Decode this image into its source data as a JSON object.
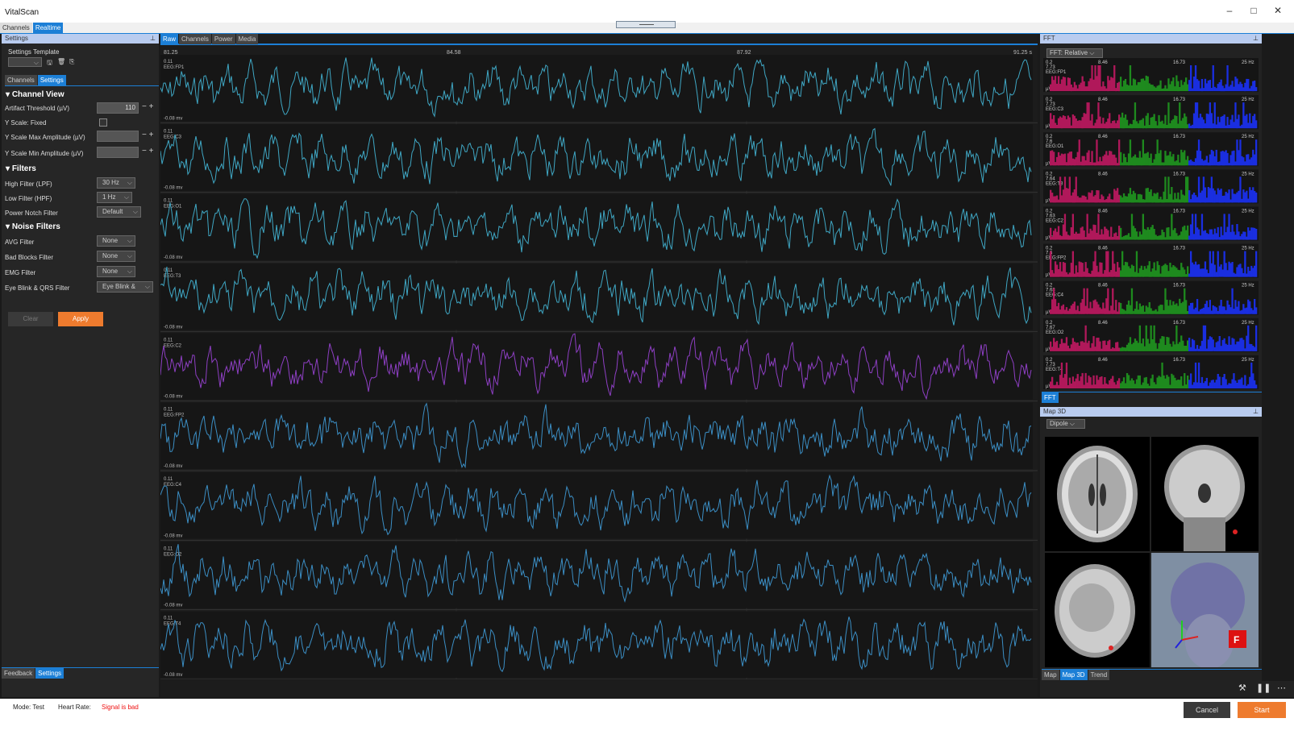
{
  "app": {
    "title": "VitalScan"
  },
  "top_tabs": [
    {
      "label": "Channels"
    },
    {
      "label": "Realtime"
    }
  ],
  "settings_panel": {
    "title": "Settings",
    "template_label": "Settings Template",
    "sub_tabs": [
      {
        "label": "Channels"
      },
      {
        "label": "Settings"
      }
    ],
    "channel_view": {
      "title": "Channel View",
      "artifact_threshold_label": "Artifact Threshold (µV)",
      "artifact_threshold_value": "110",
      "y_scale_fixed_label": "Y Scale: Fixed",
      "y_max_label": "Y Scale Max Amplitude (µV)",
      "y_min_label": "Y Scale Min Amplitude (µV)"
    },
    "filters": {
      "title": "Filters",
      "high_label": "High Filter (LPF)",
      "high_value": "30 Hz",
      "low_label": "Low Filter (HPF)",
      "low_value": "1 Hz",
      "notch_label": "Power Notch Filter",
      "notch_value": "Default"
    },
    "noise_filters": {
      "title": "Noise Filters",
      "avg_label": "AVG Filter",
      "avg_value": "None",
      "bad_blocks_label": "Bad Blocks Filter",
      "bad_blocks_value": "None",
      "emg_label": "EMG Filter",
      "emg_value": "None",
      "eye_blink_label": "Eye Blink & QRS Filter",
      "eye_blink_value": "Eye Blink &"
    },
    "clear_label": "Clear",
    "apply_label": "Apply",
    "bottom_tabs": [
      {
        "label": "Feedback"
      },
      {
        "label": "Settings"
      }
    ]
  },
  "center": {
    "tabs": [
      {
        "label": "Raw"
      },
      {
        "label": "Channels"
      },
      {
        "label": "Power"
      },
      {
        "label": "Media"
      }
    ],
    "time_ticks": [
      "81.25",
      "84.58",
      "87.92",
      "91.25 s"
    ],
    "amp_top": "0.11",
    "amp_bottom": "-0.08 mv",
    "channels": [
      {
        "name": "EEG:FP1",
        "color": "#3fa7c4"
      },
      {
        "name": "EEG:C3",
        "color": "#3fa7c4"
      },
      {
        "name": "EEG:O1",
        "color": "#3fa7c4"
      },
      {
        "name": "EEG:T3",
        "color": "#3fa7c4"
      },
      {
        "name": "EEG:C2",
        "color": "#8e3fc4"
      },
      {
        "name": "EEG:FP2",
        "color": "#3b8ec4"
      },
      {
        "name": "EEG:C4",
        "color": "#3b8ec4"
      },
      {
        "name": "EEG:O2",
        "color": "#3b8ec4"
      },
      {
        "name": "EEG:T4",
        "color": "#3b8ec4"
      }
    ]
  },
  "fft_panel": {
    "title": "FFT",
    "mode_value": "FFT: Relative",
    "freq_ticks": [
      "8.46",
      "16.73",
      "25 Hz"
    ],
    "y_top": "0.2",
    "y_unit": "µV²",
    "band_colors": [
      "#b0185a",
      "#1e8a1e",
      "#1a2ee0"
    ],
    "channels": [
      {
        "name": "EEG:FP1",
        "sub": "7.73"
      },
      {
        "name": "EEG:C3",
        "sub": "7.73"
      },
      {
        "name": "EEG:O1",
        "sub": "7.6"
      },
      {
        "name": "EEG:T3",
        "sub": "7.64"
      },
      {
        "name": "EEG:C2",
        "sub": "7.63"
      },
      {
        "name": "EEG:FP2",
        "sub": "7.6"
      },
      {
        "name": "EEG:C4",
        "sub": "7.68"
      },
      {
        "name": "EEG:O2",
        "sub": "7.67"
      },
      {
        "name": "EEG:T4",
        "sub": "7.73"
      }
    ],
    "bottom_tab": "FFT"
  },
  "map_panel": {
    "title": "Map 3D",
    "mode_value": "Dipole",
    "bottom_tabs": [
      {
        "label": "Map"
      },
      {
        "label": "Map 3D"
      },
      {
        "label": "Trend"
      }
    ],
    "cube_label": "F"
  },
  "status": {
    "mode": "Mode: Test",
    "heart_rate_label": "Heart Rate:",
    "signal_status": "Signal is bad",
    "cancel_label": "Cancel",
    "start_label": "Start"
  }
}
